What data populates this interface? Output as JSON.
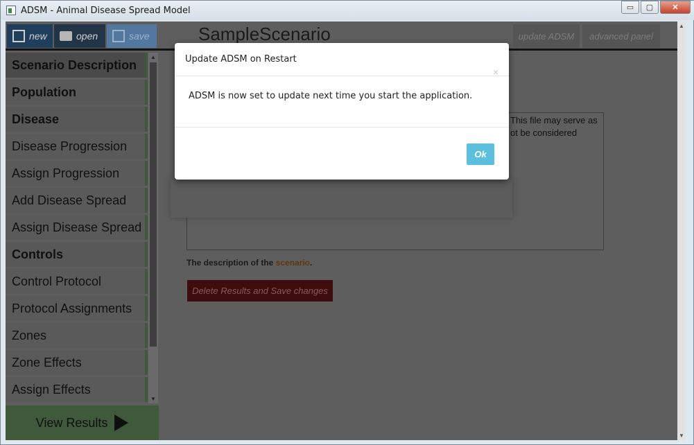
{
  "window": {
    "title": "ADSM - Animal Disease Spread Model",
    "controls": {
      "minimize": "▭",
      "maximize": "▢",
      "close": "✕"
    }
  },
  "toolbar": {
    "new_label": "new",
    "open_label": "open",
    "save_label": "save",
    "scenario_title": "SampleScenario",
    "update_label": "update ADSM",
    "advanced_label": "advanced panel"
  },
  "sidebar": {
    "items": [
      {
        "label": "Scenario Description",
        "section": true
      },
      {
        "label": "Population",
        "section": true
      },
      {
        "label": "Disease",
        "section": true
      },
      {
        "label": "Disease Progression",
        "section": false
      },
      {
        "label": "Assign Progression",
        "section": false
      },
      {
        "label": "Add Disease Spread",
        "section": false
      },
      {
        "label": "Assign Disease Spread",
        "section": false
      },
      {
        "label": "Controls",
        "section": true
      },
      {
        "label": "Control Protocol",
        "section": false
      },
      {
        "label": "Protocol Assignments",
        "section": false
      },
      {
        "label": "Zones",
        "section": false
      },
      {
        "label": "Zone Effects",
        "section": false
      },
      {
        "label": "Assign Effects",
        "section": false
      }
    ],
    "view_results_label": "View Results"
  },
  "form": {
    "description_partial": "This file may serve as ot be considered",
    "help_prefix": "The description of the ",
    "help_link": "scenario",
    "help_suffix": ".",
    "delete_label": "Delete Results and Save changes"
  },
  "modal": {
    "title": "Update ADSM on Restart",
    "close_glyph": "×",
    "message": "ADSM is now set to update next time you start the application.",
    "ok_label": "Ok"
  },
  "colors": {
    "modal_ok": "#5bc0de",
    "sidebar_accent": "#3f5a3a",
    "delete_button": "#3d0c0c"
  }
}
